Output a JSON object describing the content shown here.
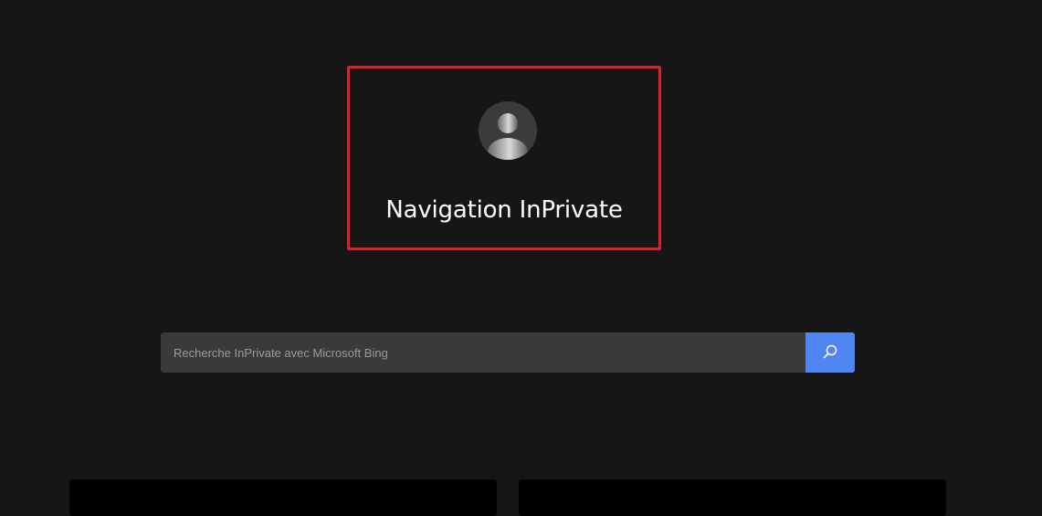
{
  "hero": {
    "title": "Navigation InPrivate",
    "avatar_icon": "person-icon",
    "highlight_color": "#e01f2c"
  },
  "search": {
    "placeholder": "Recherche InPrivate avec Microsoft Bing",
    "value": "",
    "button_icon": "search-icon",
    "button_color": "#5085f2"
  },
  "cards": [
    {
      "name": "card-left"
    },
    {
      "name": "card-right"
    }
  ],
  "colors": {
    "background": "#161616",
    "search_field": "#3a3a3a",
    "card": "#000000"
  }
}
